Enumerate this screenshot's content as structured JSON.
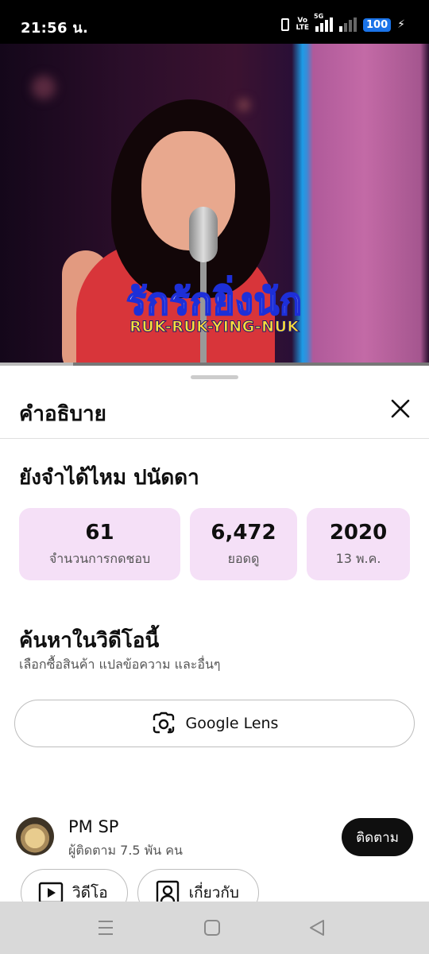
{
  "status_bar": {
    "time": "21:56 น.",
    "volte_top": "Vo",
    "volte_bottom": "LTE",
    "network": "5G",
    "battery": "100"
  },
  "video": {
    "caption_thai": "รักรักยิ่งนัก",
    "caption_roman": "RUK-RUK-YING-NUK",
    "progress": 0.15,
    "buffered": 0.17
  },
  "sheet": {
    "title": "คำอธิบาย",
    "video_title": "ยังจำได้ไหม ปนัดดา",
    "stats": [
      {
        "value": "61",
        "label": "จำนวนการกดชอบ"
      },
      {
        "value": "6,472",
        "label": "ยอดดู"
      },
      {
        "value": "2020",
        "label": "13 พ.ค."
      }
    ],
    "search_title": "ค้นหาในวิดีโอนี้",
    "search_subtitle": "เลือกซื้อสินค้า แปลข้อความ และอื่นๆ",
    "lens_label": "Google Lens",
    "channel": {
      "name": "PM SP",
      "subscribers": "ผู้ติดตาม 7.5 พัน คน",
      "subscribe_label": "ติดตาม"
    },
    "chips": [
      {
        "label": "วิดีโอ",
        "icon": "play-box-icon"
      },
      {
        "label": "เกี่ยวกับ",
        "icon": "person-box-icon"
      }
    ]
  },
  "colors": {
    "stat_bg": "#f5e0f7",
    "progress": "#ff0000",
    "subscribe_bg": "#0f0f0f",
    "battery_bg": "#1a73e8"
  }
}
